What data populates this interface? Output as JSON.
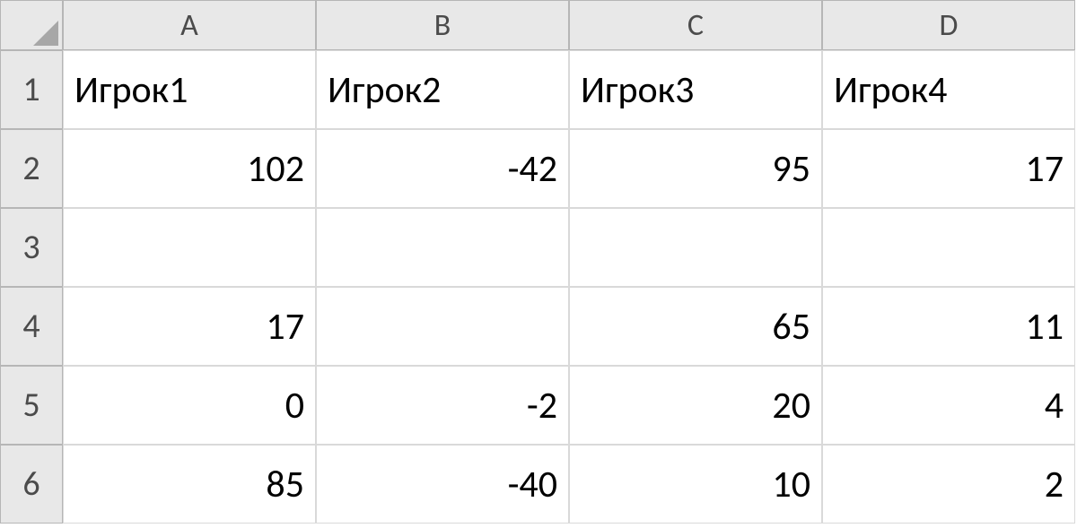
{
  "columns": [
    "A",
    "B",
    "C",
    "D"
  ],
  "rows": [
    "1",
    "2",
    "3",
    "4",
    "5",
    "6"
  ],
  "cells": {
    "A1": {
      "v": "Игрок1",
      "t": "txt"
    },
    "B1": {
      "v": "Игрок2",
      "t": "txt"
    },
    "C1": {
      "v": "Игрок3",
      "t": "txt"
    },
    "D1": {
      "v": "Игрок4",
      "t": "txt"
    },
    "A2": {
      "v": "102",
      "t": "num"
    },
    "B2": {
      "v": "-42",
      "t": "num"
    },
    "C2": {
      "v": "95",
      "t": "num"
    },
    "D2": {
      "v": "17",
      "t": "num"
    },
    "A3": {
      "v": "",
      "t": "txt"
    },
    "B3": {
      "v": "",
      "t": "txt"
    },
    "C3": {
      "v": "",
      "t": "txt"
    },
    "D3": {
      "v": "",
      "t": "txt"
    },
    "A4": {
      "v": "17",
      "t": "num"
    },
    "B4": {
      "v": "",
      "t": "txt"
    },
    "C4": {
      "v": "65",
      "t": "num"
    },
    "D4": {
      "v": "11",
      "t": "num"
    },
    "A5": {
      "v": "0",
      "t": "num"
    },
    "B5": {
      "v": "-2",
      "t": "num"
    },
    "C5": {
      "v": "20",
      "t": "num"
    },
    "D5": {
      "v": "4",
      "t": "num"
    },
    "A6": {
      "v": "85",
      "t": "num"
    },
    "B6": {
      "v": "-40",
      "t": "num"
    },
    "C6": {
      "v": "10",
      "t": "num"
    },
    "D6": {
      "v": "2",
      "t": "num"
    }
  }
}
